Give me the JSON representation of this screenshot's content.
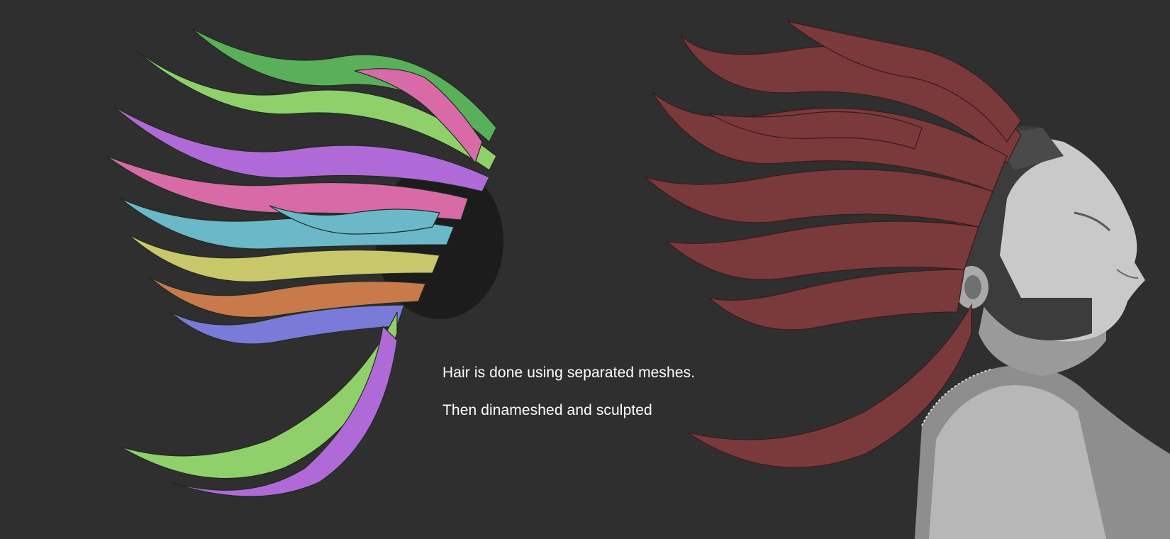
{
  "caption": {
    "line1": "Hair is done using separated meshes.",
    "line2": "Then dinameshed and sculpted"
  },
  "colors": {
    "background": "#2f2f2f",
    "caption_text": "#ffffff",
    "sculpted_hair": "#7a3a3c",
    "skin_grey": "#bdbdbd",
    "polygroup_palette": [
      "#8fd06a",
      "#b06ad8",
      "#d86aa8",
      "#6ab8c8",
      "#c8c86a",
      "#c87a4a",
      "#7a7ad8",
      "#5ab05a"
    ]
  },
  "panels": {
    "left": "polygroup-hair-meshes",
    "right": "sculpted-hair-with-head"
  }
}
